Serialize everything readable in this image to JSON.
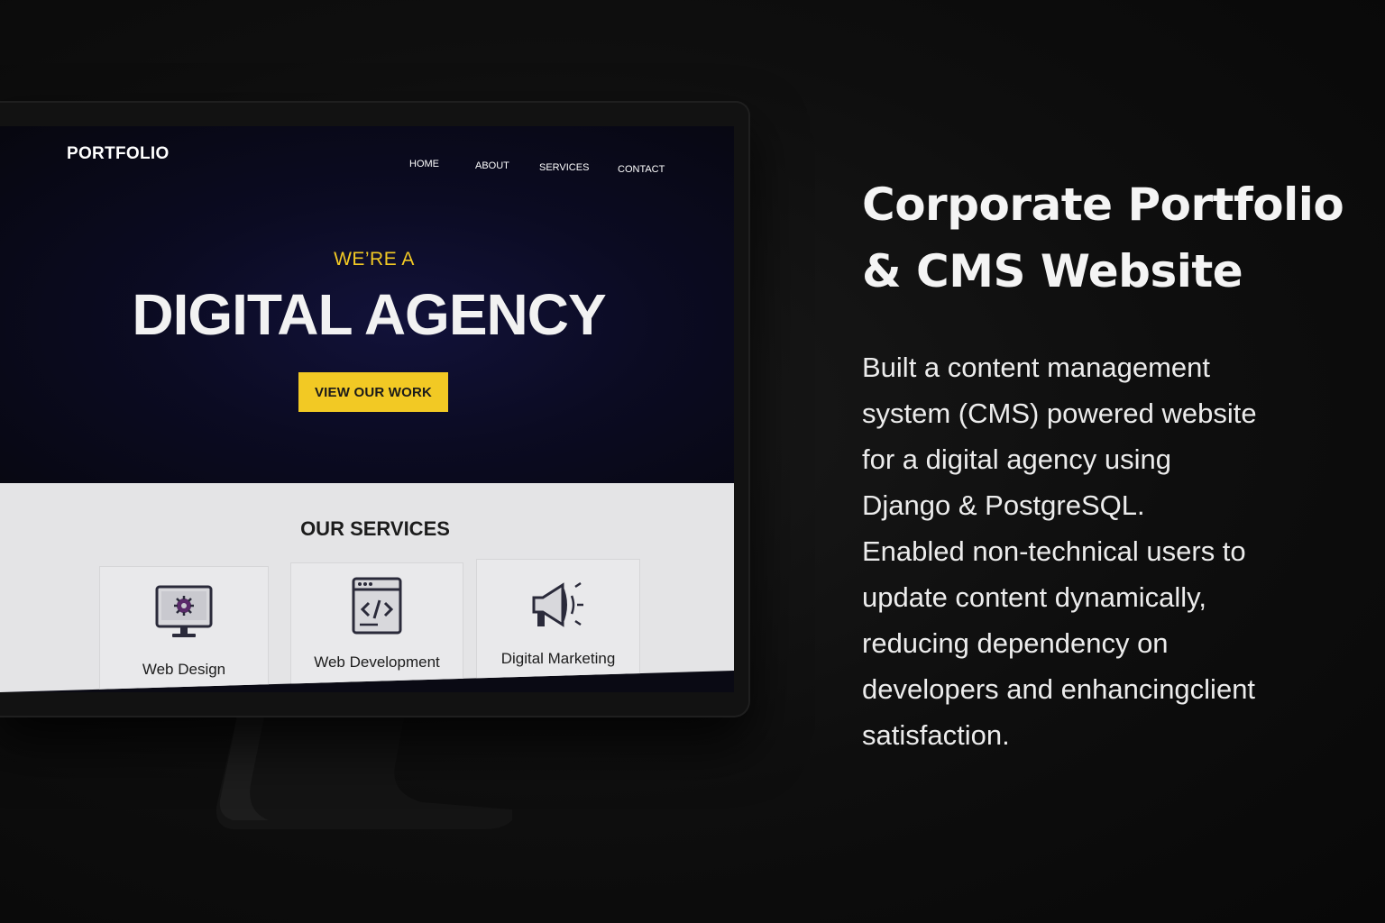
{
  "site": {
    "brand": "PORTFOLIO",
    "nav": [
      {
        "label": "HOME"
      },
      {
        "label": "ABOUT"
      },
      {
        "label": "SERVICES"
      },
      {
        "label": "CONTACT"
      }
    ],
    "hero": {
      "eyebrow": "WE’RE A",
      "headline": "DIGITAL AGENCY",
      "cta_label": "VIEW OUR WORK"
    },
    "services": {
      "title": "OUR SERVICES",
      "items": [
        {
          "label": "Web Design",
          "icon": "monitor-gear-icon"
        },
        {
          "label": "Web Development",
          "icon": "code-window-icon"
        },
        {
          "label": "Digital Marketing",
          "icon": "megaphone-icon"
        }
      ]
    }
  },
  "copy": {
    "title_lines": [
      "Corporate Portfolio",
      "& CMS Website"
    ],
    "body_lines": [
      "Built a content management",
      "system (CMS) powered website",
      "for a digital agency using",
      "Django & PostgreSQL.",
      "Enabled non-technical users to",
      "update content dynamically,",
      "reducing dependency on",
      "developers and enhancingclient",
      "satisfaction."
    ]
  },
  "colors": {
    "accent_yellow": "#f2c924",
    "background": "#0c0c0c",
    "hero_navy": "#0b0b22",
    "services_bg": "#e4e4e6"
  }
}
